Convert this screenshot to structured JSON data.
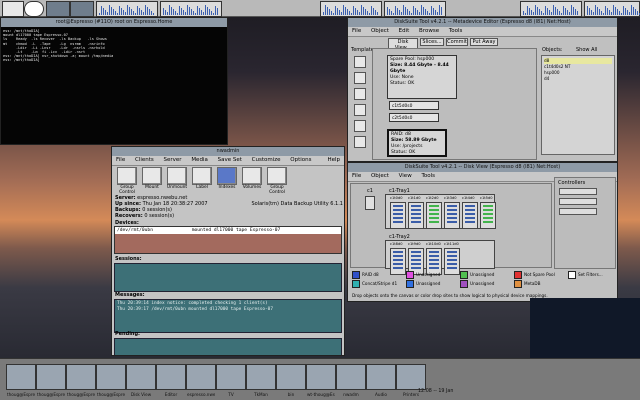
{
  "topbar": {
    "cells": [
      "",
      "",
      "",
      "",
      "",
      "",
      "",
      "",
      ""
    ]
  },
  "terminal": {
    "title": "root@Espresso (#11O) root on Espresso.Home",
    "lines": [
      "ess: /mnt/thoDIA]",
      "mount dl17000 tape Espresso-07",
      "",
      "ls    Ready  -ls Recover  -ls Backup   -ls Shows",
      "mt    chmod  -L  -Tape    -Lg  nsrmm   -nsrinfo",
      "      -Ldir  -Li -Lnsr    -Ldr  -nsrls -nsrhold",
      "      -Lt    -Lm  fi -Lcv  -Ldir -nsrt",
      "ess: /mnt/thoDIA] nsr_shutdown -a; mount /tmp/media",
      "ess: /mnt/thoDIA]"
    ]
  },
  "backup": {
    "title": "nwadmin",
    "menus": [
      "File",
      "Clients",
      "Server",
      "Media",
      "Save Set",
      "Customize",
      "Options",
      "Help"
    ],
    "tools": [
      "Group Control",
      "Mount",
      "Unmount",
      "Label",
      "Indexes",
      "Volumes",
      "Group Control"
    ],
    "server_label": "Server:",
    "server_value": "espresso.nwebu.net",
    "server_extra": "Solaris(tm) Data Backup Utility 6.1.1",
    "upsince_label": "Up since:",
    "upsince_value": "Thu Jan 18 20:38:27 2007",
    "backups_label": "Backups:",
    "backups_value": "0 session(s)",
    "recovers_label": "Recovers:",
    "recovers_value": "0 session(s)",
    "devices_label": "Devices:",
    "device_path": "/dev/rmt/0ubn",
    "device_drive": "dl17000 tape Espresso-07",
    "device_state": "mounted dl17000 tape Espresso-07",
    "sessions_label": "Sessions:",
    "messages_label": "Messages:",
    "messages": [
      "Thu 20:39:14 index notice: completed checking 1 client(s)",
      "Thu 20:39:17 /dev/rmt/0ubn mounted dl17000 tape Espresso-07"
    ],
    "pending_label": "Pending:"
  },
  "stor1": {
    "title": "DiskSuite Tool v4.2.1 -- Metadevice Editor (Espresso d8 (l81) Net:Host)",
    "menus": [
      "File",
      "Object",
      "Edit",
      "Browse",
      "Tools"
    ],
    "buttons": [
      "Disk View...",
      "Slices...",
      "Commit",
      "Put Away"
    ],
    "templates_label": "Templates",
    "objects_label": "Objects:",
    "show_all": "Show All",
    "spare_title": "Spare Pool: hsp000",
    "spare_size": "Size: 8.44 Gbyte - 8.44 Gbyte",
    "spare_use": "Use: None",
    "spare_status": "Status: OK",
    "spare_slice1": "c1t5d0s0",
    "spare_slice2": "c2t5d0s0",
    "raid_title": "RAID: d8",
    "raid_size": "Size: 58.89 Gbyte",
    "raid_use": "Use: /projects",
    "raid_status": "Status: OK",
    "objects": [
      "d8",
      "c1t4d0s2 NT",
      "hsp000",
      "d4"
    ]
  },
  "stor2": {
    "title": "DiskSuite Tool v4.2.1 -- Disk View (Espresso d8 (l81) Net:Host)",
    "menus": [
      "File",
      "Object",
      "View",
      "Tools"
    ],
    "controllers_label": "Controllers",
    "c1": "c1",
    "c1_tray1": "c1-Tray1",
    "c1_tray2": "c1-Tray2",
    "tray1_ids": [
      "c1t0d0",
      "c1t1d0",
      "c1t2d0",
      "c1t3d0",
      "c1t4d0",
      "c1t5d0"
    ],
    "tray2_ids": [
      "c1t8d0",
      "c1t9d0",
      "c1t10d0",
      "c1t11d0"
    ],
    "legend": [
      {
        "label": "RAID d8",
        "color": "#3050c8"
      },
      {
        "label": "Unassigned",
        "color": "#e050e0"
      },
      {
        "label": "Unassigned",
        "color": "#50c050"
      },
      {
        "label": "Not Spare Pool",
        "color": "#e03030"
      },
      {
        "label": "Set Filters...",
        "color": "#ffffff"
      },
      {
        "label": "Concat/Stripe d1",
        "color": "#30b0b0"
      },
      {
        "label": "Unassigned",
        "color": "#3070e0"
      },
      {
        "label": "Unassigned",
        "color": "#a050c0"
      },
      {
        "label": "MetaDB",
        "color": "#e09040"
      }
    ],
    "status_text": "Drop objects onto the canvas or color drop sites to show logical to physical device mappings."
  },
  "taskbar": {
    "items": [
      "thoug@Espresso",
      "thoug@Espresso",
      "thoug@Espresso",
      "thoug@Espresso",
      "Disk View",
      "Editor",
      "espresso.nwebu.net",
      "TV",
      "TkMan",
      "bin",
      "wt-thoug@Espres",
      "nwadm",
      "Audio",
      "Printers"
    ],
    "clock": "12:08 -- 19 Jan"
  },
  "colors": {
    "accent": "#5e6e88",
    "teal": "#3d7077",
    "device_row": "#a36a5e"
  }
}
